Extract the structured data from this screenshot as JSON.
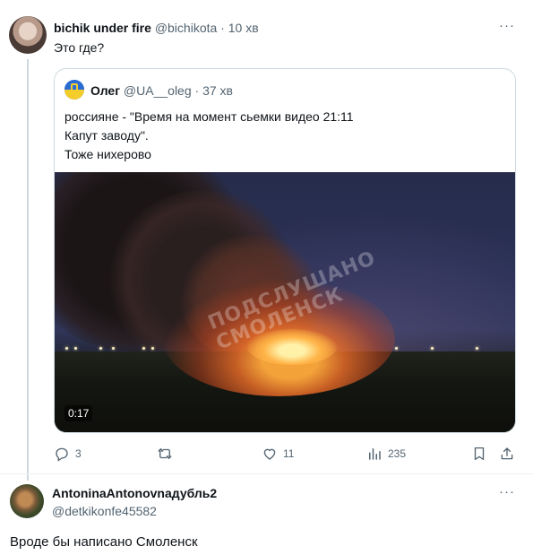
{
  "tweet1": {
    "author_name": "bichik under fire",
    "author_handle": "@bichikota",
    "time": "10 хв",
    "text": "Это где?",
    "quote": {
      "author_name": "Олег",
      "author_handle": "@UA__oleg",
      "time": "37 хв",
      "lines": [
        "россияне - \"Время на момент сьемки видео 21:11",
        "Капут заводу\".",
        "Тоже нихерово"
      ],
      "video": {
        "duration": "0:17",
        "watermark_line1": "ПОДСЛУШАНО",
        "watermark_line2": "СМОЛЕНСК"
      }
    },
    "actions": {
      "replies": "3",
      "retweets": "",
      "likes": "11",
      "views": "235"
    }
  },
  "tweet2": {
    "author_name": "AntoninaAntonovnaдубль2",
    "author_handle": "@detkikonfe45582",
    "text": "Вроде бы написано Смоленск"
  },
  "icons": {
    "reply": "reply-icon",
    "retweet": "retweet-icon",
    "like": "heart-icon",
    "views": "views-icon",
    "bookmark": "bookmark-icon",
    "share": "share-icon",
    "more": "more-icon"
  },
  "colors": {
    "text": "#0f1419",
    "secondary": "#536471",
    "border": "#cfd9de"
  }
}
